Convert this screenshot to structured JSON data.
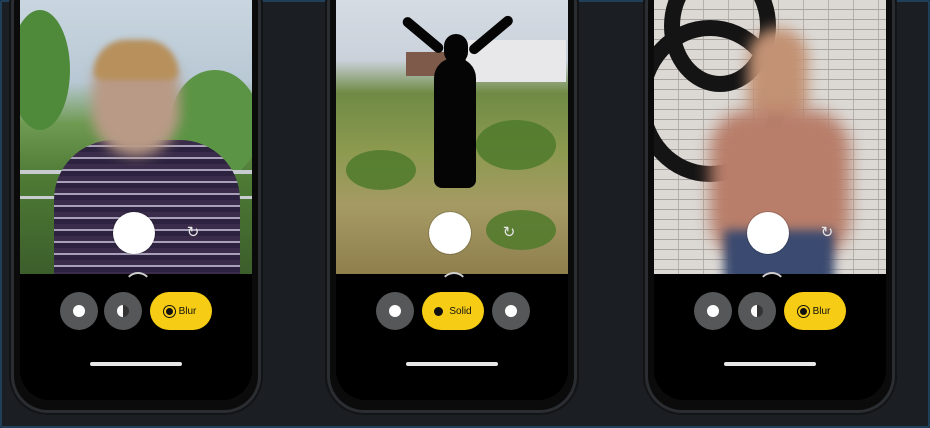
{
  "phones": [
    {
      "modes": [
        {
          "icon": "dot-icon"
        },
        {
          "icon": "half-dot-icon"
        },
        {
          "label": "Blur",
          "active": true,
          "icon": "blur-dot-icon"
        }
      ]
    },
    {
      "modes": [
        {
          "icon": "dot-icon"
        },
        {
          "label": "Solid",
          "active": true,
          "icon": "solid-dot-icon"
        },
        {
          "icon": "dot-icon"
        }
      ]
    },
    {
      "modes": [
        {
          "icon": "dot-icon"
        },
        {
          "icon": "half-dot-icon"
        },
        {
          "label": "Blur",
          "active": true,
          "icon": "blur-dot-icon"
        }
      ]
    }
  ],
  "switch_camera_icon": "↻",
  "colors": {
    "accent": "#f7cc14",
    "mode_button": "#555758",
    "background": "#1b1f24"
  }
}
